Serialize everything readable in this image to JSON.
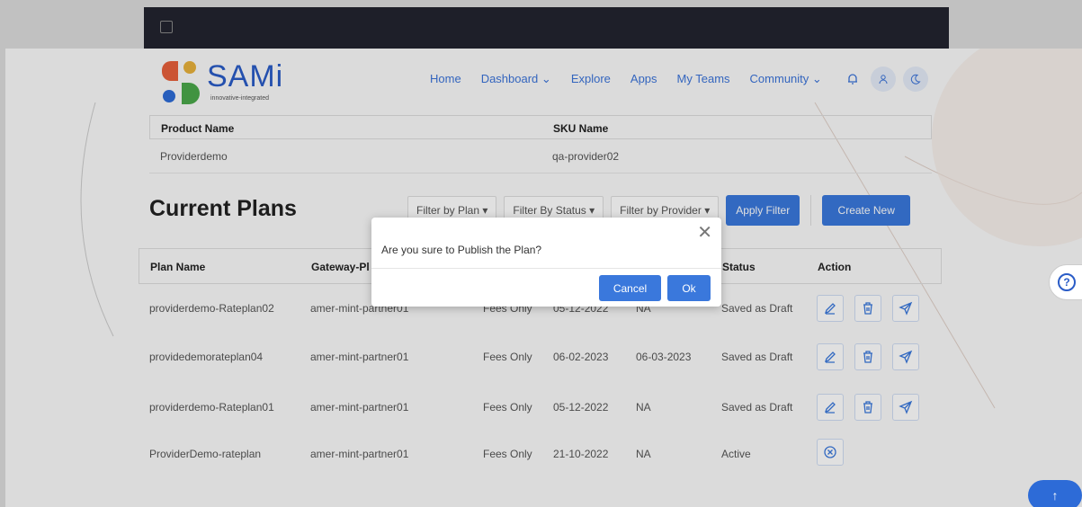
{
  "header": {
    "logo_text": "SAMi",
    "logo_tagline": "innovative-integrated",
    "nav": [
      "Home",
      "Dashboard",
      "Explore",
      "Apps",
      "My Teams",
      "Community"
    ]
  },
  "product_table": {
    "columns": [
      "Product Name",
      "SKU Name"
    ],
    "row": [
      "Providerdemo",
      "qa-provider02"
    ]
  },
  "plans_section": {
    "title": "Current Plans",
    "filters": [
      "Filter by Plan",
      "Filter By Status",
      "Filter by Provider"
    ],
    "apply_label": "Apply Filter",
    "create_label": "Create New"
  },
  "plans_table": {
    "columns": [
      "Plan Name",
      "Gateway-Pl",
      "Status",
      "Action"
    ],
    "rows": [
      {
        "name": "providerdemo-Rateplan02",
        "gateway": "amer-mint-partner01",
        "type": "Fees Only",
        "start": "05-12-2022",
        "end": "NA",
        "status": "Saved as Draft"
      },
      {
        "name": "providedemorateplan04",
        "gateway": "amer-mint-partner01",
        "type": "Fees Only",
        "start": "06-02-2023",
        "end": "06-03-2023",
        "status": "Saved as Draft"
      },
      {
        "name": "providerdemo-Rateplan01",
        "gateway": "amer-mint-partner01",
        "type": "Fees Only",
        "start": "05-12-2022",
        "end": "NA",
        "status": "Saved as Draft"
      },
      {
        "name": "ProviderDemo-rateplan",
        "gateway": "amer-mint-partner01",
        "type": "Fees Only",
        "start": "21-10-2022",
        "end": "NA",
        "status": "Active"
      }
    ]
  },
  "modal": {
    "message": "Are you sure to Publish the Plan?",
    "cancel_label": "Cancel",
    "ok_label": "Ok"
  },
  "colors": {
    "accent": "#3a78dc",
    "topbar": "#23242f"
  }
}
